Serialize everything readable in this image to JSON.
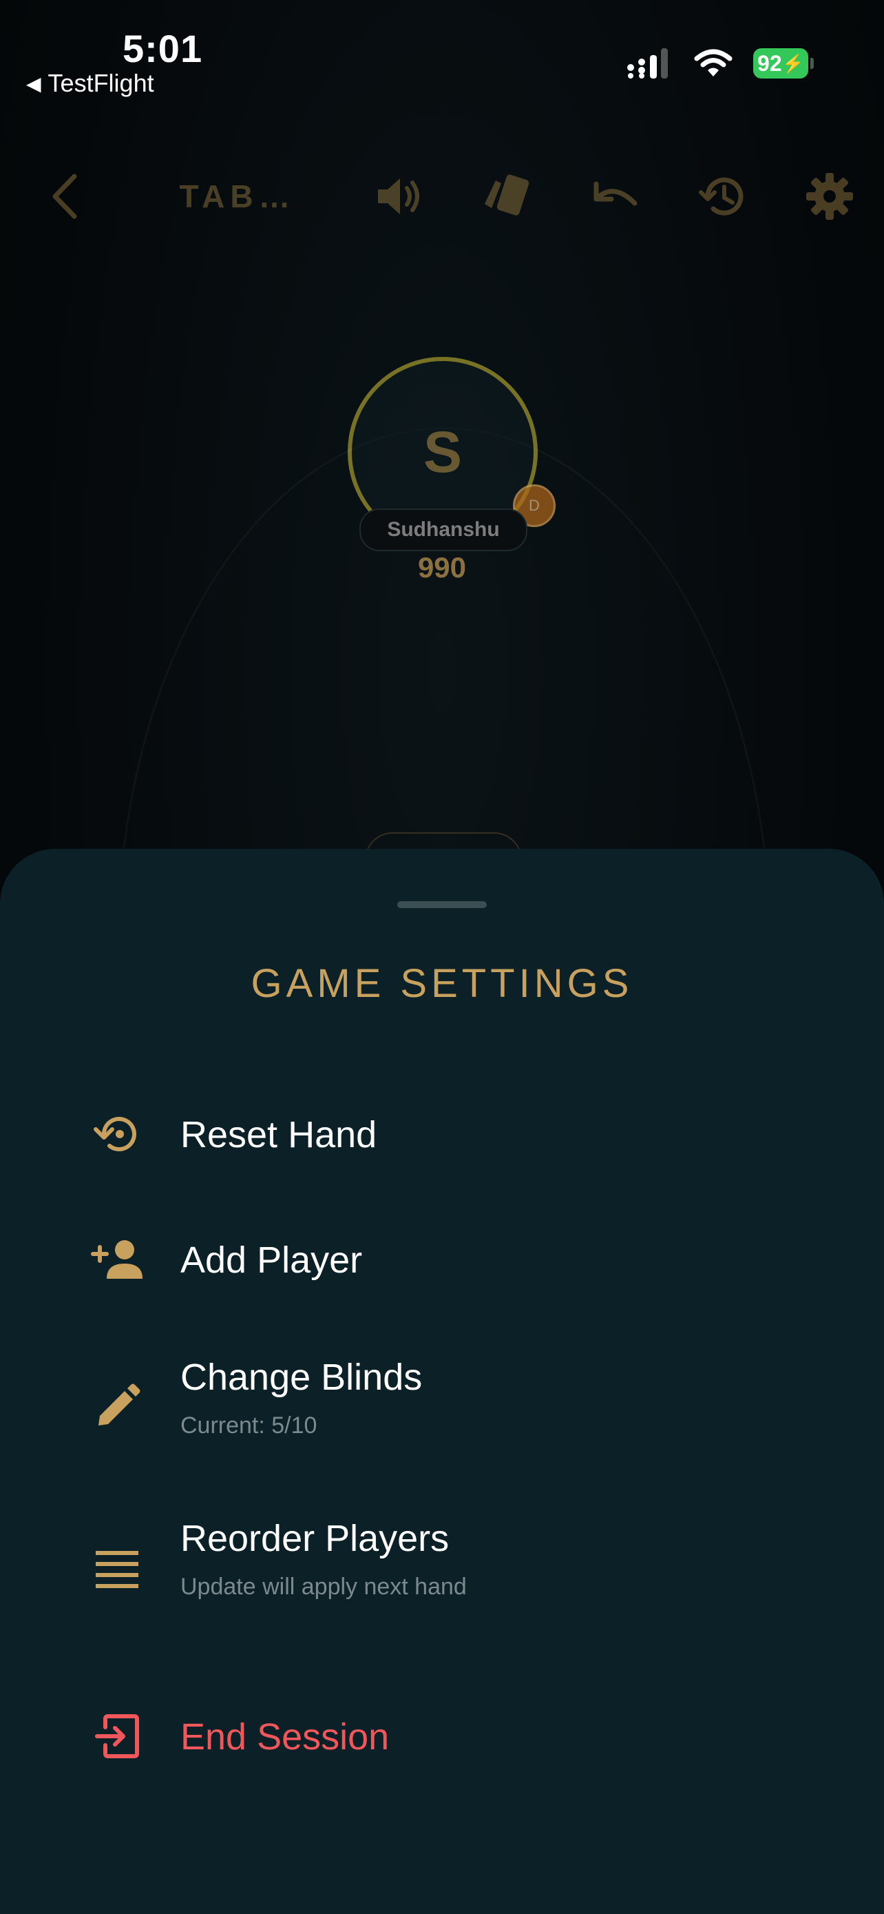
{
  "status_bar": {
    "time": "5:01",
    "back_app": "TestFlight",
    "battery": "92"
  },
  "toolbar": {
    "title": "TAB…",
    "icons": [
      "chevron-left-icon",
      "speaker-icon",
      "cards-icon",
      "undo-icon",
      "history-icon",
      "gear-icon"
    ]
  },
  "table": {
    "player": {
      "initial": "S",
      "name": "Sudhanshu",
      "chips": "990",
      "dealer_label": "D"
    }
  },
  "sheet": {
    "title": "GAME SETTINGS",
    "items": [
      {
        "label": "Reset Hand",
        "sub": ""
      },
      {
        "label": "Add Player",
        "sub": ""
      },
      {
        "label": "Change Blinds",
        "sub": "Current: 5/10"
      },
      {
        "label": "Reorder Players",
        "sub": "Update will apply next hand"
      },
      {
        "label": "End Session",
        "sub": ""
      }
    ]
  },
  "colors": {
    "accent": "#c9a15e",
    "sheet_bg": "#0c2127",
    "danger": "#f0575a",
    "battery": "#34c759"
  }
}
